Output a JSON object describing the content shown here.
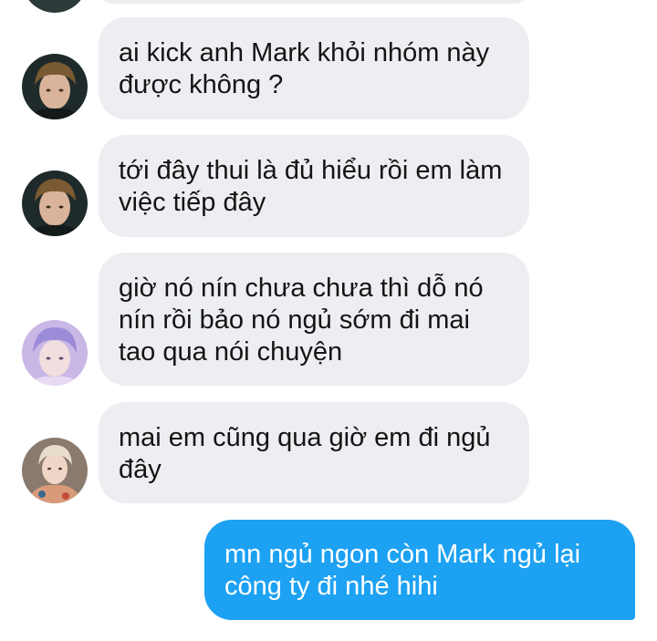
{
  "messages": [
    {
      "sender": "incoming",
      "avatar": "avatar-dark-hair",
      "text": "ai kick anh Mark khỏi nhóm này được không ?"
    },
    {
      "sender": "incoming",
      "avatar": "avatar-dark-hair",
      "text": "tới đây thui là đủ hiểu rồi em làm việc tiếp đây"
    },
    {
      "sender": "incoming",
      "avatar": "avatar-pink-purple",
      "text": "giờ nó nín chưa chưa thì dỗ nó nín rồi bảo nó ngủ sớm đi mai tao qua nói chuyện"
    },
    {
      "sender": "incoming",
      "avatar": "avatar-light-hair",
      "text": "mai em cũng qua giờ em đi ngủ đây"
    },
    {
      "sender": "outgoing",
      "text": "mn ngủ ngon còn Mark ngủ lại công ty đi nhé hihi"
    }
  ],
  "colors": {
    "incoming_bubble": "#eceef1",
    "outgoing_bubble": "#1da1f2",
    "incoming_text": "#141414",
    "outgoing_text": "#ffffff"
  }
}
